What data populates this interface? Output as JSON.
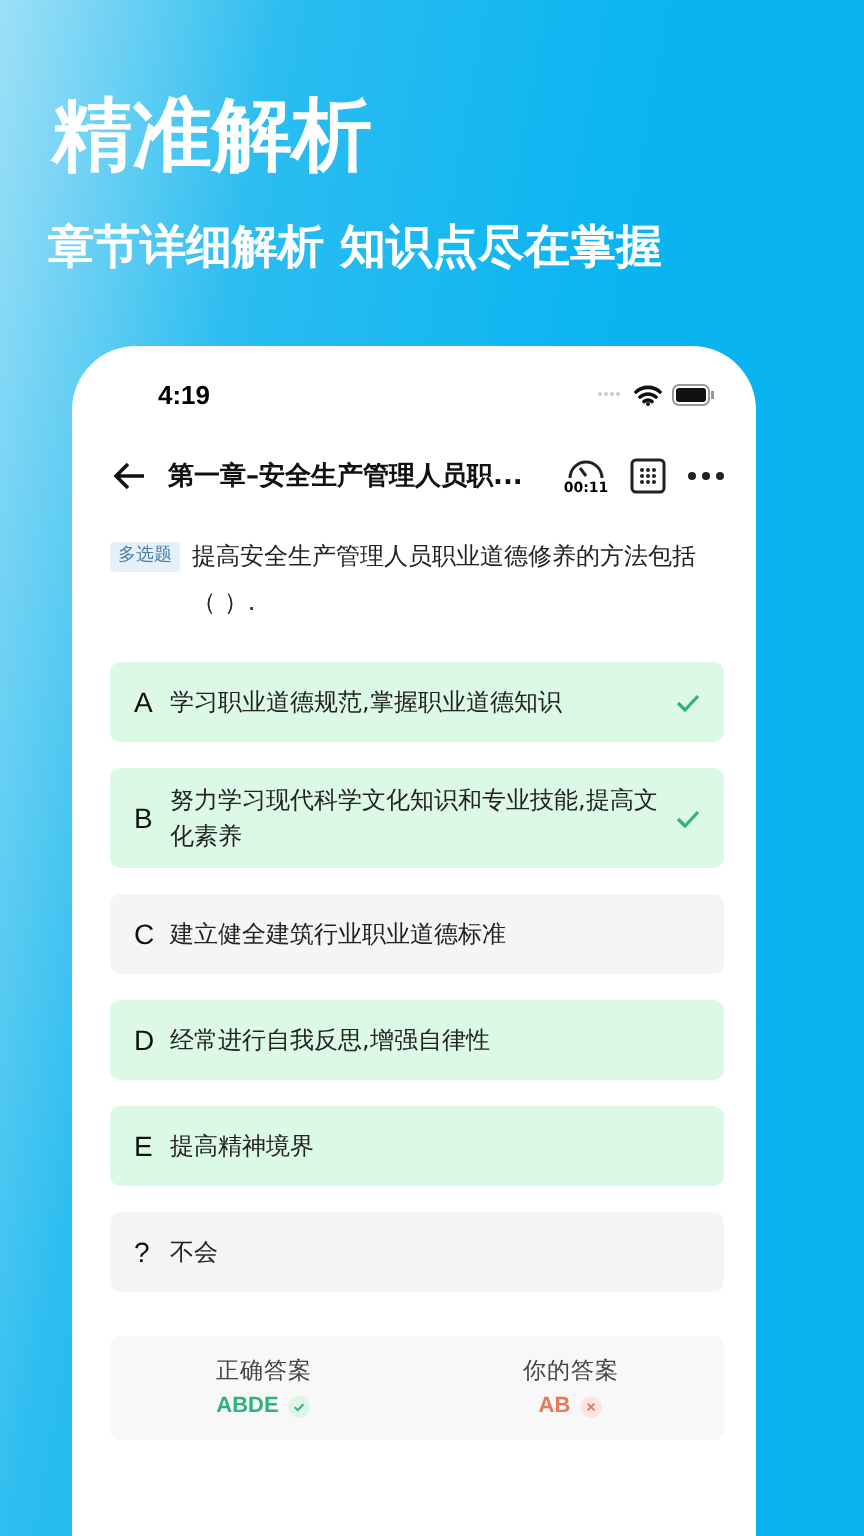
{
  "headline": "精准解析",
  "subtitle": "章节详细解析 知识点尽在掌握",
  "status_bar": {
    "time": "4:19"
  },
  "nav": {
    "title": "第一章–安全生产管理人员职...",
    "timer": "00:11"
  },
  "question": {
    "tag": "多选题",
    "text": "提高安全生产管理人员职业道德修养的方法包括（ ）."
  },
  "options": [
    {
      "letter": "A",
      "text": "学习职业道德规范,掌握职业道德知识",
      "correct": true,
      "checked": true
    },
    {
      "letter": "B",
      "text": "努力学习现代科学文化知识和专业技能,提高文化素养",
      "correct": true,
      "checked": true
    },
    {
      "letter": "C",
      "text": "建立健全建筑行业职业道德标准",
      "correct": false,
      "checked": false
    },
    {
      "letter": "D",
      "text": "经常进行自我反思,增强自律性",
      "correct": true,
      "checked": false
    },
    {
      "letter": "E",
      "text": "提高精神境界",
      "correct": true,
      "checked": false
    },
    {
      "letter": "?",
      "text": "不会",
      "correct": false,
      "checked": false
    }
  ],
  "answers": [
    {
      "label": "正确答案",
      "value": "ABDE",
      "kind": "right"
    },
    {
      "label": "你的答案",
      "value": "AB",
      "kind": "wrong"
    }
  ]
}
